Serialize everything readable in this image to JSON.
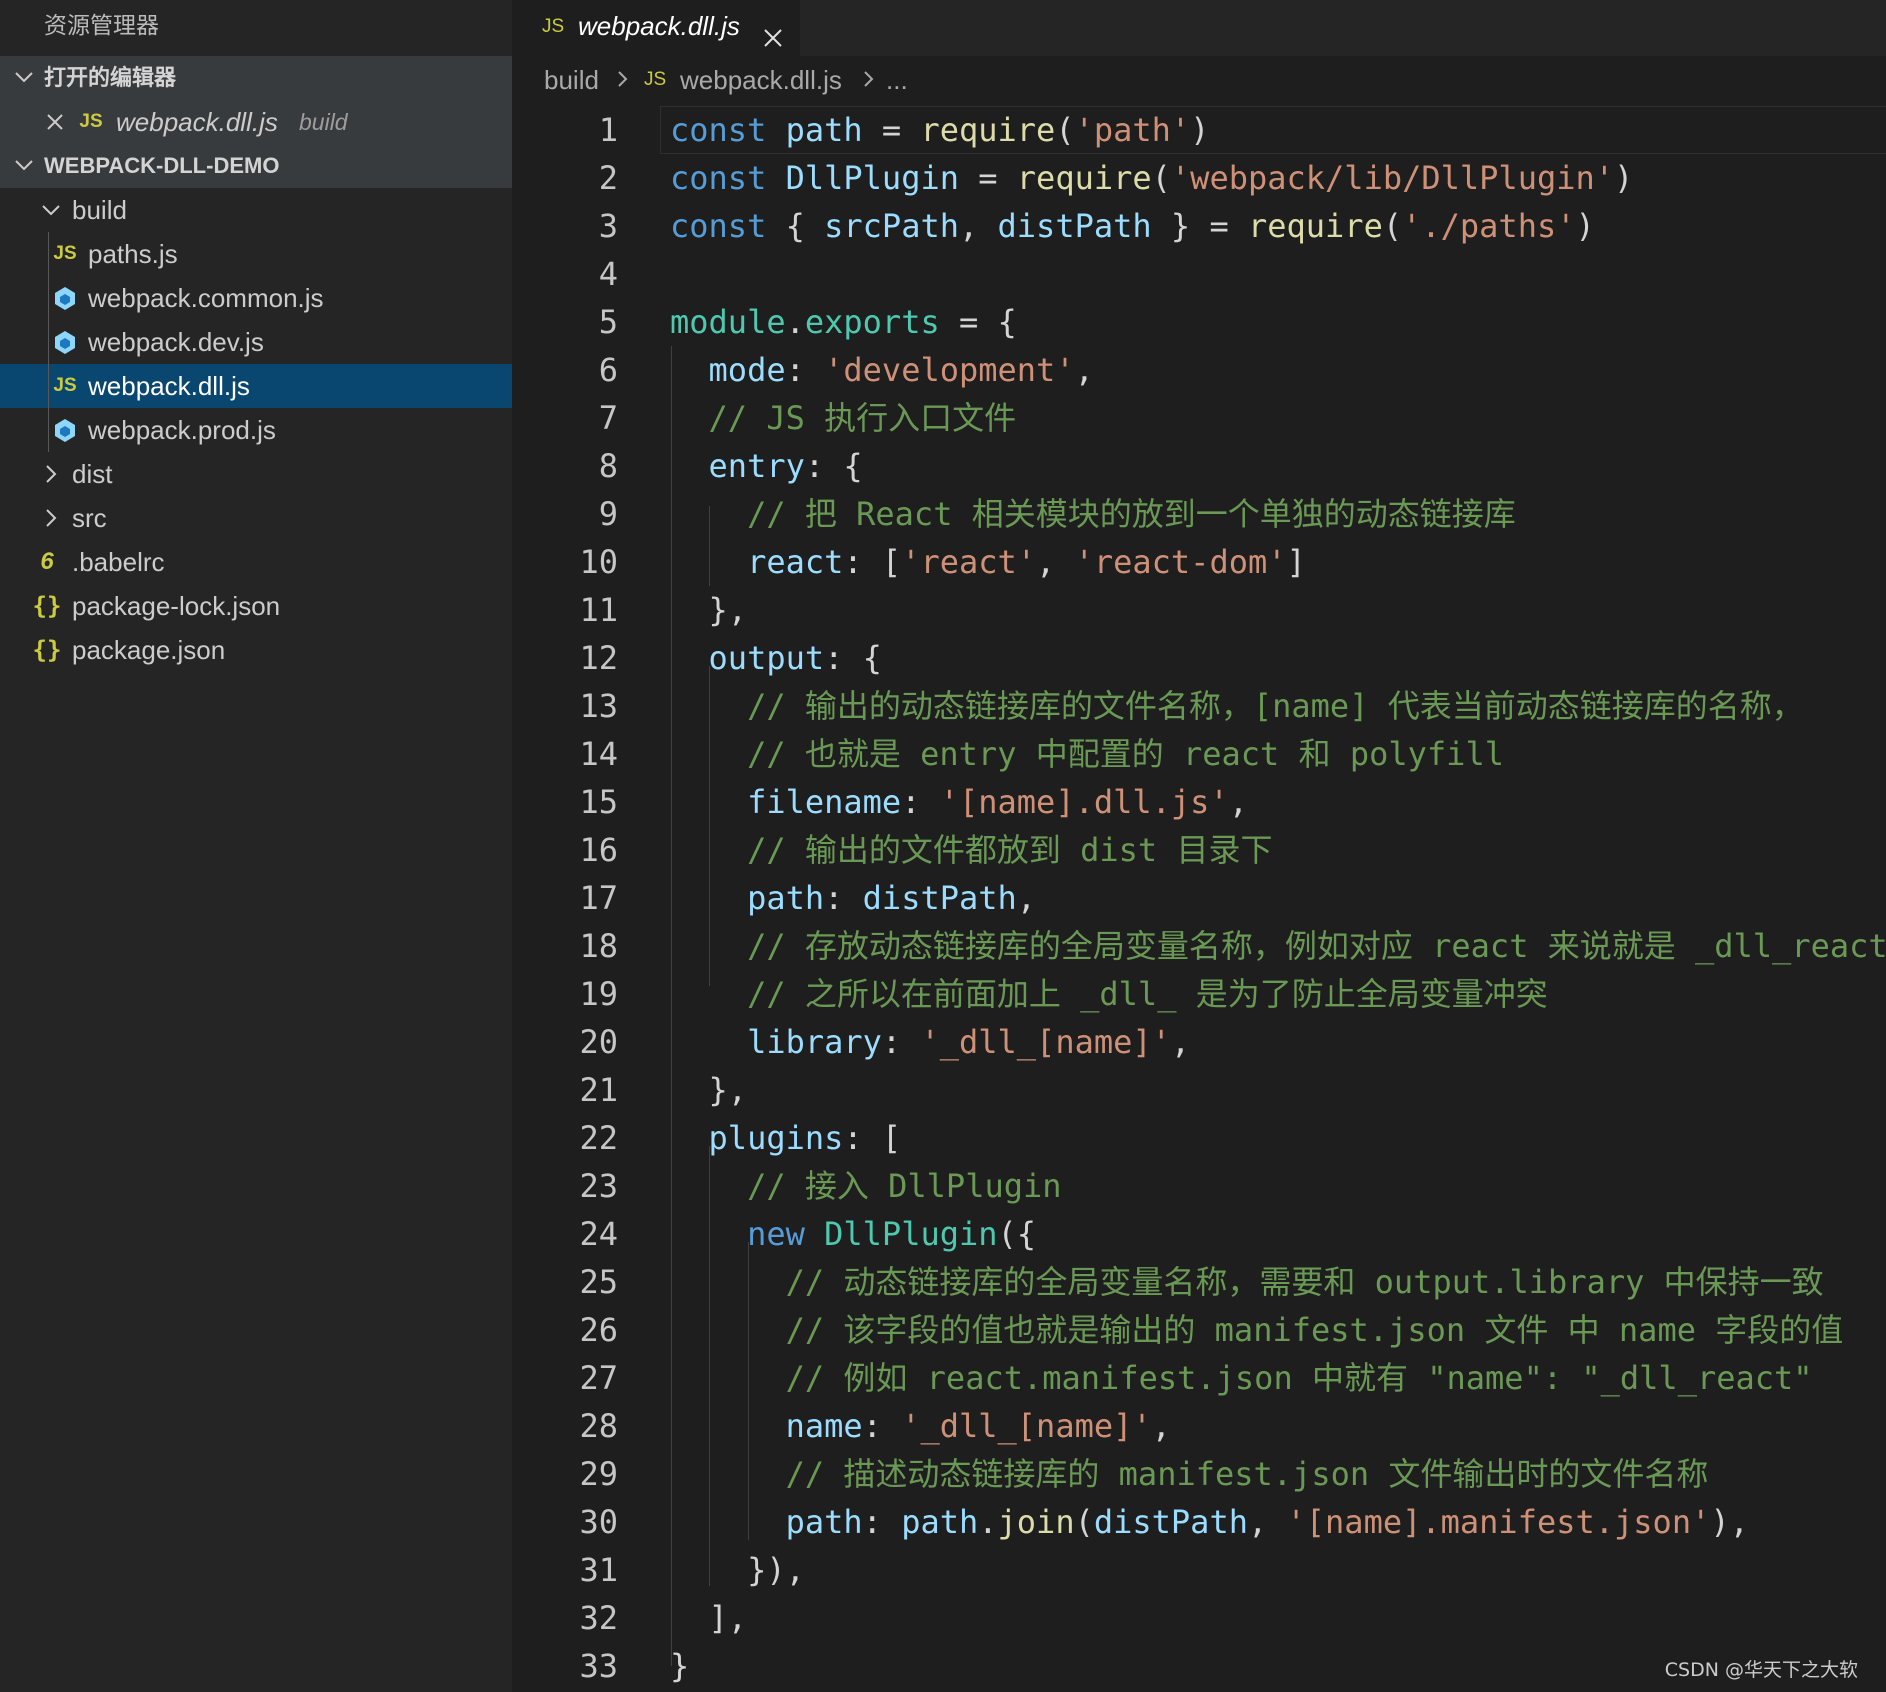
{
  "sidebar": {
    "title": "资源管理器",
    "open_editors_header": "打开的编辑器",
    "open_editor": {
      "name": "webpack.dll.js",
      "folder": "build",
      "icon": "js-file-icon"
    },
    "project_header": "WEBPACK-DLL-DEMO",
    "tree": [
      {
        "label": "build",
        "kind": "folder",
        "expanded": true
      },
      {
        "label": "paths.js",
        "kind": "file",
        "icon": "js-file-icon"
      },
      {
        "label": "webpack.common.js",
        "kind": "file",
        "icon": "webpack-file-icon"
      },
      {
        "label": "webpack.dev.js",
        "kind": "file",
        "icon": "webpack-file-icon"
      },
      {
        "label": "webpack.dll.js",
        "kind": "file",
        "icon": "js-file-icon",
        "selected": true
      },
      {
        "label": "webpack.prod.js",
        "kind": "file",
        "icon": "webpack-file-icon"
      },
      {
        "label": "dist",
        "kind": "folder",
        "expanded": false
      },
      {
        "label": "src",
        "kind": "folder",
        "expanded": false
      },
      {
        "label": ".babelrc",
        "kind": "file",
        "icon": "babel-file-icon"
      },
      {
        "label": "package-lock.json",
        "kind": "file",
        "icon": "json-file-icon"
      },
      {
        "label": "package.json",
        "kind": "file",
        "icon": "json-file-icon"
      }
    ]
  },
  "tab": {
    "label": "webpack.dll.js",
    "badge": "JS"
  },
  "breadcrumb": {
    "folder": "build",
    "file": "webpack.dll.js",
    "more": "...",
    "badge": "JS"
  },
  "badges": {
    "js": "JS",
    "json": "{}",
    "babel": "6"
  },
  "colors": {
    "sidebar_bg": "#252526",
    "editor_bg": "#1e1e1e",
    "selection": "#094771",
    "keyword": "#569cd6",
    "variable": "#9cdcfe",
    "string": "#ce9178",
    "comment": "#6a9955",
    "function": "#dcdcaa",
    "module": "#4ec9b0",
    "js_badge": "#cbcb41",
    "webpack_icon": "#8ed6fb"
  },
  "code": {
    "lines": [
      [
        [
          "kw",
          "const"
        ],
        [
          "op",
          " "
        ],
        [
          "vr",
          "path"
        ],
        [
          "op",
          " = "
        ],
        [
          "fn",
          "require"
        ],
        [
          "pn",
          "("
        ],
        [
          "st",
          "'path'"
        ],
        [
          "pn",
          ")"
        ]
      ],
      [
        [
          "kw",
          "const"
        ],
        [
          "op",
          " "
        ],
        [
          "vr",
          "DllPlugin"
        ],
        [
          "op",
          " = "
        ],
        [
          "fn",
          "require"
        ],
        [
          "pn",
          "("
        ],
        [
          "st",
          "'webpack/lib/DllPlugin'"
        ],
        [
          "pn",
          ")"
        ]
      ],
      [
        [
          "kw",
          "const"
        ],
        [
          "pn",
          " { "
        ],
        [
          "vr",
          "srcPath"
        ],
        [
          "pn",
          ", "
        ],
        [
          "vr",
          "distPath"
        ],
        [
          "pn",
          " } = "
        ],
        [
          "fn",
          "require"
        ],
        [
          "pn",
          "("
        ],
        [
          "st",
          "'./paths'"
        ],
        [
          "pn",
          ")"
        ]
      ],
      [],
      [
        [
          "md",
          "module"
        ],
        [
          "pn",
          "."
        ],
        [
          "md",
          "exports"
        ],
        [
          "op",
          " = {"
        ]
      ],
      [
        [
          "op",
          "  "
        ],
        [
          "pr",
          "mode"
        ],
        [
          "pn",
          ": "
        ],
        [
          "st",
          "'development'"
        ],
        [
          "pn",
          ","
        ]
      ],
      [
        [
          "op",
          "  "
        ],
        [
          "cm",
          "// JS 执行入口文件"
        ]
      ],
      [
        [
          "op",
          "  "
        ],
        [
          "pr",
          "entry"
        ],
        [
          "pn",
          ": {"
        ]
      ],
      [
        [
          "op",
          "    "
        ],
        [
          "cm",
          "// 把 React 相关模块的放到一个单独的动态链接库"
        ]
      ],
      [
        [
          "op",
          "    "
        ],
        [
          "pr",
          "react"
        ],
        [
          "pn",
          ": ["
        ],
        [
          "st",
          "'react'"
        ],
        [
          "pn",
          ", "
        ],
        [
          "st",
          "'react-dom'"
        ],
        [
          "pn",
          "]"
        ]
      ],
      [
        [
          "op",
          "  "
        ],
        [
          "pn",
          "},"
        ]
      ],
      [
        [
          "op",
          "  "
        ],
        [
          "pr",
          "output"
        ],
        [
          "pn",
          ": {"
        ]
      ],
      [
        [
          "op",
          "    "
        ],
        [
          "cm",
          "// 输出的动态链接库的文件名称，[name] 代表当前动态链接库的名称，"
        ]
      ],
      [
        [
          "op",
          "    "
        ],
        [
          "cm",
          "// 也就是 entry 中配置的 react 和 polyfill"
        ]
      ],
      [
        [
          "op",
          "    "
        ],
        [
          "pr",
          "filename"
        ],
        [
          "pn",
          ": "
        ],
        [
          "st",
          "'[name].dll.js'"
        ],
        [
          "pn",
          ","
        ]
      ],
      [
        [
          "op",
          "    "
        ],
        [
          "cm",
          "// 输出的文件都放到 dist 目录下"
        ]
      ],
      [
        [
          "op",
          "    "
        ],
        [
          "pr",
          "path"
        ],
        [
          "pn",
          ": "
        ],
        [
          "vr",
          "distPath"
        ],
        [
          "pn",
          ","
        ]
      ],
      [
        [
          "op",
          "    "
        ],
        [
          "cm",
          "// 存放动态链接库的全局变量名称，例如对应 react 来说就是 _dll_react"
        ]
      ],
      [
        [
          "op",
          "    "
        ],
        [
          "cm",
          "// 之所以在前面加上 _dll_ 是为了防止全局变量冲突"
        ]
      ],
      [
        [
          "op",
          "    "
        ],
        [
          "pr",
          "library"
        ],
        [
          "pn",
          ": "
        ],
        [
          "st",
          "'_dll_[name]'"
        ],
        [
          "pn",
          ","
        ]
      ],
      [
        [
          "op",
          "  "
        ],
        [
          "pn",
          "},"
        ]
      ],
      [
        [
          "op",
          "  "
        ],
        [
          "pr",
          "plugins"
        ],
        [
          "pn",
          ": ["
        ]
      ],
      [
        [
          "op",
          "    "
        ],
        [
          "cm",
          "// 接入 DllPlugin"
        ]
      ],
      [
        [
          "op",
          "    "
        ],
        [
          "kw",
          "new"
        ],
        [
          "op",
          " "
        ],
        [
          "md",
          "DllPlugin"
        ],
        [
          "pn",
          "({"
        ]
      ],
      [
        [
          "op",
          "      "
        ],
        [
          "cm",
          "// 动态链接库的全局变量名称，需要和 output.library 中保持一致"
        ]
      ],
      [
        [
          "op",
          "      "
        ],
        [
          "cm",
          "// 该字段的值也就是输出的 manifest.json 文件 中 name 字段的值"
        ]
      ],
      [
        [
          "op",
          "      "
        ],
        [
          "cm",
          "// 例如 react.manifest.json 中就有 \"name\": \"_dll_react\""
        ]
      ],
      [
        [
          "op",
          "      "
        ],
        [
          "pr",
          "name"
        ],
        [
          "pn",
          ": "
        ],
        [
          "st",
          "'_dll_[name]'"
        ],
        [
          "pn",
          ","
        ]
      ],
      [
        [
          "op",
          "      "
        ],
        [
          "cm",
          "// 描述动态链接库的 manifest.json 文件输出时的文件名称"
        ]
      ],
      [
        [
          "op",
          "      "
        ],
        [
          "pr",
          "path"
        ],
        [
          "pn",
          ": "
        ],
        [
          "vr",
          "path"
        ],
        [
          "pn",
          "."
        ],
        [
          "fn",
          "join"
        ],
        [
          "pn",
          "("
        ],
        [
          "vr",
          "distPath"
        ],
        [
          "pn",
          ", "
        ],
        [
          "st",
          "'[name].manifest.json'"
        ],
        [
          "pn",
          "),"
        ]
      ],
      [
        [
          "op",
          "    "
        ],
        [
          "pn",
          "}),"
        ]
      ],
      [
        [
          "op",
          "  "
        ],
        [
          "pn",
          "],"
        ]
      ],
      [
        [
          "pn",
          "}"
        ]
      ]
    ]
  },
  "watermark": "CSDN @华天下之大软"
}
